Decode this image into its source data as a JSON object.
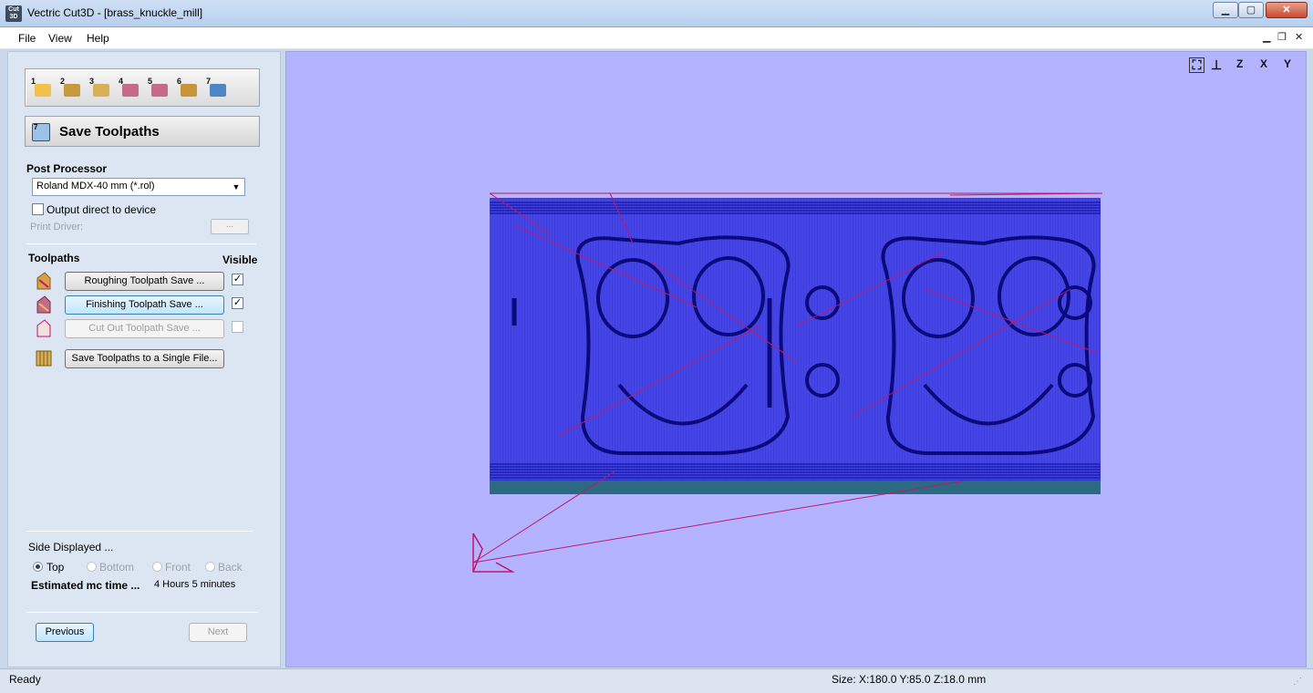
{
  "window": {
    "app_icon_label": "Cut 3D",
    "title": "Vectric Cut3D - [brass_knuckle_mill]",
    "minimize": "▁",
    "maximize": "▢",
    "close": "✕"
  },
  "menu": {
    "file": "File",
    "view": "View",
    "help": "Help",
    "mdi_minimize": "▁",
    "mdi_restore": "❐",
    "mdi_close": "✕"
  },
  "toolbar": {
    "steps": [
      {
        "num": "1",
        "icon": "open-folder-icon",
        "color": "#f2c14a"
      },
      {
        "num": "2",
        "icon": "orient-model-icon",
        "color": "#c89a40"
      },
      {
        "num": "3",
        "icon": "material-setup-icon",
        "color": "#d8b05a"
      },
      {
        "num": "4",
        "icon": "roughing-toolpath-icon",
        "color": "#c46a8a"
      },
      {
        "num": "5",
        "icon": "finishing-toolpath-icon",
        "color": "#c46a8a"
      },
      {
        "num": "6",
        "icon": "cutout-toolpath-icon",
        "color": "#c8963a"
      },
      {
        "num": "7",
        "icon": "save-toolpaths-icon",
        "color": "#4f86c6"
      }
    ]
  },
  "panel": {
    "step_num": "7",
    "title": "Save Toolpaths",
    "post_processor_label": "Post Processor",
    "post_processor_value": "Roland MDX-40 mm (*.rol)",
    "output_direct_label": "Output direct to device",
    "print_driver_label": "Print Driver:",
    "print_driver_button": "...",
    "toolpaths_label": "Toolpaths",
    "visible_label": "Visible",
    "toolpaths": [
      {
        "label": "Roughing Toolpath Save ...",
        "visible": "✓"
      },
      {
        "label": "Finishing Toolpath Save ...",
        "visible": "✓"
      },
      {
        "label": "Cut Out Toolpath Save ...",
        "visible": ""
      }
    ],
    "single_file_button": "Save Toolpaths to a Single File...",
    "side_displayed_label": "Side Displayed ...",
    "sides": [
      "Top",
      "Bottom",
      "Front",
      "Back"
    ],
    "estimated_label": "Estimated mc time ...",
    "estimated_value": "4 Hours 5 minutes",
    "previous_button": "Previous",
    "next_button": "Next"
  },
  "viewport": {
    "background": "#b3b3ff",
    "toolpath_color": "#1a1acc",
    "rapid_color": "#c0186a",
    "base_color": "#2b6a80",
    "view_buttons": [
      "fit-view-icon",
      "iso-view-icon",
      "top-z-view-icon",
      "front-x-view-icon",
      "side-y-view-icon"
    ],
    "view_labels": [
      "⛶",
      "⊥",
      "Z",
      "X",
      "Y"
    ]
  },
  "status": {
    "ready": "Ready",
    "size": "Size: X:180.0 Y:85.0 Z:18.0 mm"
  }
}
